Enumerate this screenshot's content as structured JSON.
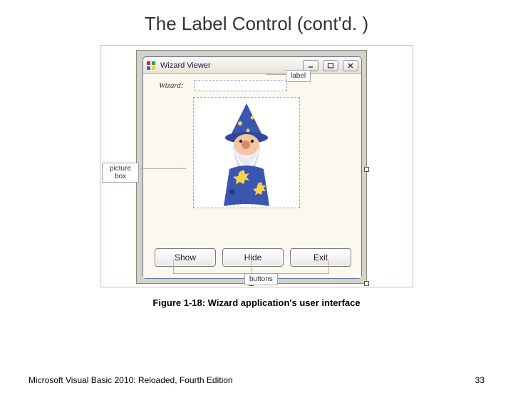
{
  "title": "The Label Control (cont'd. )",
  "caption": "Figure 1-18: Wizard application's user interface",
  "footer": {
    "text": "Microsoft Visual Basic 2010: Reloaded, Fourth Edition",
    "page": "33"
  },
  "window": {
    "title": "Wizard Viewer",
    "caption_label": "Wizard:",
    "buttons": {
      "show": "Show",
      "hide": "Hide",
      "exit": "Exit"
    }
  },
  "callouts": {
    "label": "label",
    "picturebox": "picture box",
    "buttons": "buttons"
  }
}
